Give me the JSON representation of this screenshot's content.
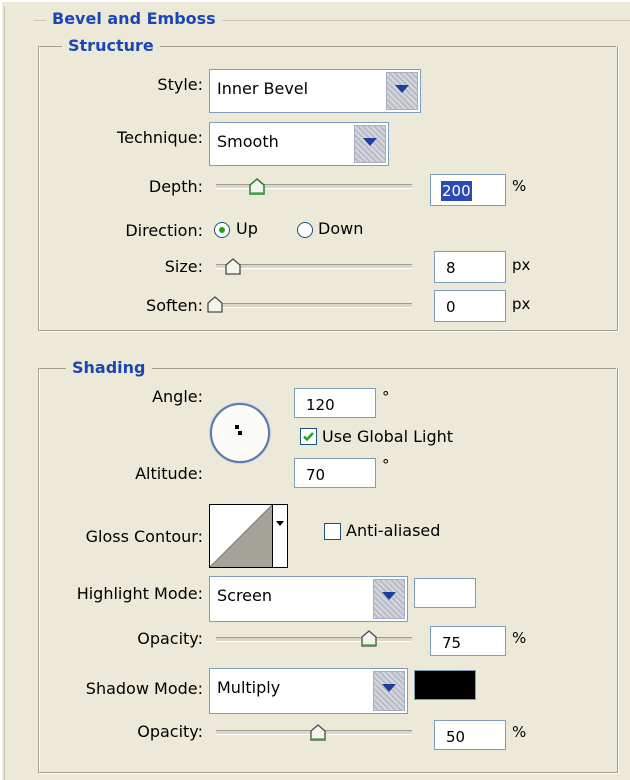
{
  "bevel": {
    "title": "Bevel and Emboss",
    "structure": {
      "title": "Structure",
      "style": {
        "label": "Style:",
        "value": "Inner Bevel"
      },
      "technique": {
        "label": "Technique:",
        "value": "Smooth"
      },
      "depth": {
        "label": "Depth:",
        "value": "200",
        "unit": "%"
      },
      "direction": {
        "label": "Direction:",
        "options": [
          "Up",
          "Down"
        ],
        "selected": "Up"
      },
      "size": {
        "label": "Size:",
        "value": "8",
        "unit": "px"
      },
      "soften": {
        "label": "Soften:",
        "value": "0",
        "unit": "px"
      }
    },
    "shading": {
      "title": "Shading",
      "angle": {
        "label": "Angle:",
        "value": "120",
        "unit": "°"
      },
      "use_global_light": {
        "label": "Use Global Light",
        "checked": true
      },
      "altitude": {
        "label": "Altitude:",
        "value": "70",
        "unit": "°"
      },
      "gloss_contour": {
        "label": "Gloss Contour:"
      },
      "anti_aliased": {
        "label": "Anti-aliased",
        "checked": false
      },
      "highlight_mode": {
        "label": "Highlight Mode:",
        "value": "Screen",
        "color": "#ffffff"
      },
      "highlight_opacity": {
        "label": "Opacity:",
        "value": "75",
        "unit": "%"
      },
      "shadow_mode": {
        "label": "Shadow Mode:",
        "value": "Multiply",
        "color": "#000000"
      },
      "shadow_opacity": {
        "label": "Opacity:",
        "value": "50",
        "unit": "%"
      }
    }
  }
}
